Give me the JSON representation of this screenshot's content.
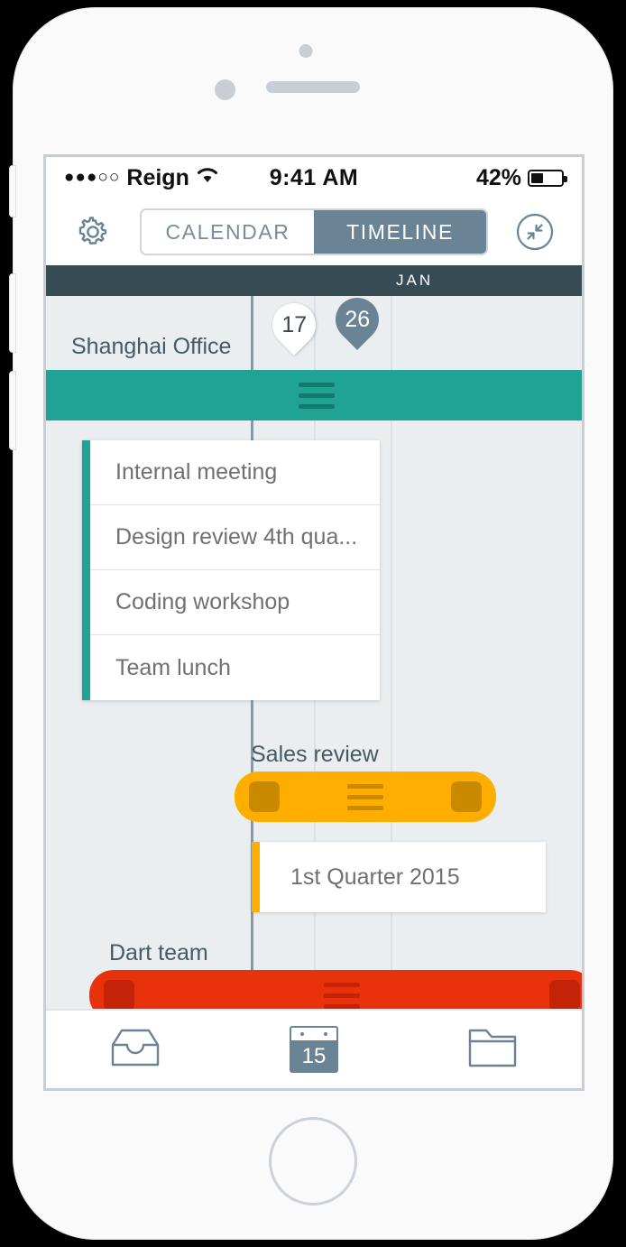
{
  "status_bar": {
    "signal_dots": "●●●○○",
    "carrier": "Reign",
    "wifi_icon": "wifi-icon",
    "time": "9:41 AM",
    "battery_percent": "42%",
    "battery_level": 42
  },
  "app_bar": {
    "settings_icon": "gear-icon",
    "collapse_icon": "collapse-arrows-icon",
    "segments": [
      {
        "label": "CALENDAR",
        "active": false
      },
      {
        "label": "TIMELINE",
        "active": true
      }
    ]
  },
  "timeline": {
    "month_label": "JAN",
    "pins": [
      {
        "label": "17",
        "style": "light"
      },
      {
        "label": "26",
        "style": "dark"
      }
    ],
    "rows": [
      {
        "name": "Shanghai Office",
        "bar_color": "#20a394",
        "tasks": [
          "Internal meeting",
          "Design review 4th qua...",
          "Coding workshop",
          "Team lunch"
        ]
      },
      {
        "name": "Sales review",
        "bar_color": "#ffae00",
        "detail_card": "1st Quarter 2015"
      },
      {
        "name": "Dart team",
        "bar_color": "#e8320c"
      }
    ]
  },
  "tab_bar": {
    "tabs": [
      {
        "name": "inbox",
        "icon": "inbox-icon",
        "active": false
      },
      {
        "name": "calendar",
        "icon": "calendar-icon",
        "day": "15",
        "active": true
      },
      {
        "name": "files",
        "icon": "folder-icon",
        "active": false
      }
    ]
  },
  "theme": {
    "teal": "#20a394",
    "orange": "#ffae00",
    "red": "#e8320c",
    "slate": "#6b8495",
    "header_dark": "#374b55",
    "canvas": "#eaeef0"
  }
}
